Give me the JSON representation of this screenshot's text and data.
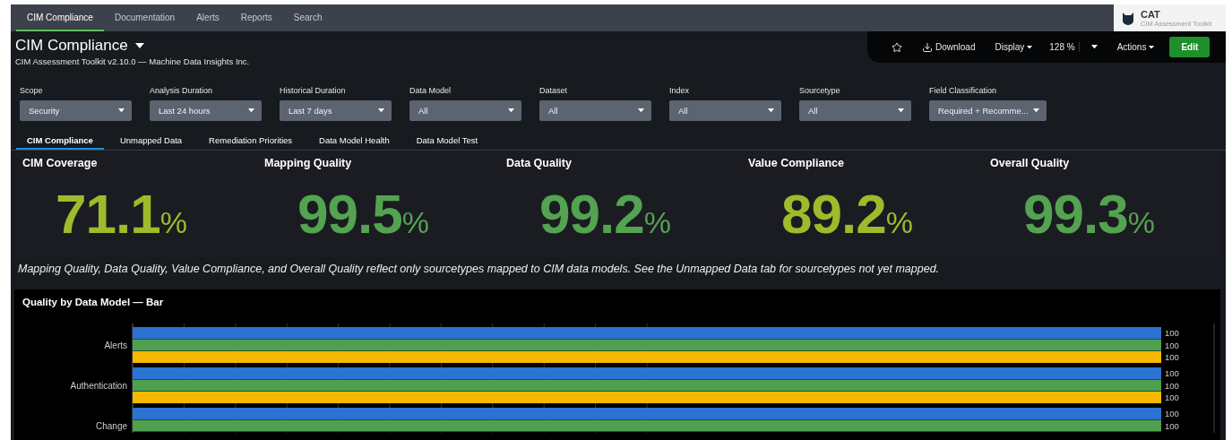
{
  "nav": {
    "tabs": [
      {
        "label": "CIM Compliance",
        "selected": true
      },
      {
        "label": "Documentation",
        "selected": false
      },
      {
        "label": "Alerts",
        "selected": false
      },
      {
        "label": "Reports",
        "selected": false
      },
      {
        "label": "Search",
        "selected": false
      }
    ],
    "app": {
      "name": "CAT",
      "subtitle": "CIM Assessment Toolkit"
    }
  },
  "header": {
    "title": "CIM Compliance",
    "subtitle": "CIM Assessment Toolkit v2.10.0 — Machine Data Insights Inc."
  },
  "toolbar": {
    "download": "Download",
    "display": "Display",
    "zoom": "128 %",
    "actions": "Actions",
    "edit": "Edit"
  },
  "filters": [
    {
      "label": "Scope",
      "value": "Security"
    },
    {
      "label": "Analysis Duration",
      "value": "Last 24 hours"
    },
    {
      "label": "Historical Duration",
      "value": "Last 7 days"
    },
    {
      "label": "Data Model",
      "value": "All"
    },
    {
      "label": "Dataset",
      "value": "All"
    },
    {
      "label": "Index",
      "value": "All"
    },
    {
      "label": "Sourcetype",
      "value": "All"
    },
    {
      "label": "Field Classification",
      "value": "Required + Recomme..."
    }
  ],
  "tabs": [
    {
      "label": "CIM Compliance",
      "selected": true
    },
    {
      "label": "Unmapped Data",
      "selected": false
    },
    {
      "label": "Remediation Priorities",
      "selected": false
    },
    {
      "label": "Data Model Health",
      "selected": false
    },
    {
      "label": "Data Model Test",
      "selected": false
    }
  ],
  "metrics": [
    {
      "title": "CIM Coverage",
      "value": "71.1",
      "unit": "%",
      "color": "#9dbb2b"
    },
    {
      "title": "Mapping Quality",
      "value": "99.5",
      "unit": "%",
      "color": "#53a351"
    },
    {
      "title": "Data Quality",
      "value": "99.2",
      "unit": "%",
      "color": "#53a351"
    },
    {
      "title": "Value Compliance",
      "value": "89.2",
      "unit": "%",
      "color": "#9dbb2b"
    },
    {
      "title": "Overall Quality",
      "value": "99.3",
      "unit": "%",
      "color": "#53a351"
    }
  ],
  "note": "Mapping Quality, Data Quality, Value Compliance, and Overall Quality reflect only sourcetypes mapped to CIM data models. See the Unmapped Data tab for sourcetypes not yet mapped.",
  "chart": {
    "title": "Quality by Data Model — Bar",
    "chart_data": {
      "type": "bar",
      "orientation": "horizontal",
      "categories": [
        "Alerts",
        "Authentication",
        "Change"
      ],
      "data_labels": true,
      "series": [
        {
          "color": "#2a73d2",
          "values": [
            100,
            100,
            100
          ]
        },
        {
          "color": "#4fa04e",
          "values": [
            100,
            100,
            100
          ]
        },
        {
          "color": "#f6b800",
          "values": [
            100,
            100,
            null
          ]
        }
      ]
    }
  }
}
